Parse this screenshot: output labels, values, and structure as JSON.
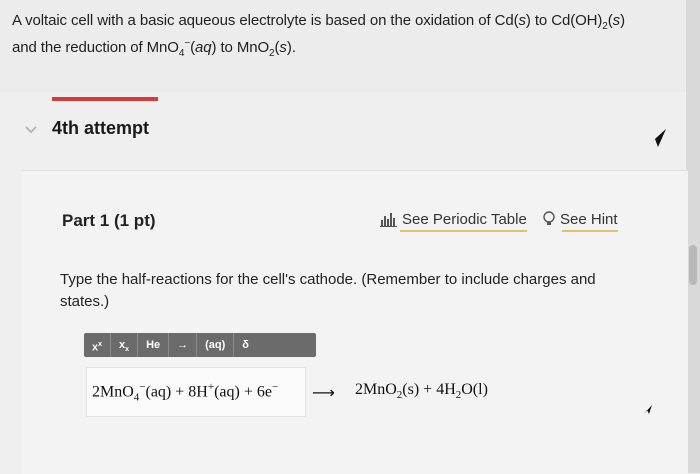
{
  "question": {
    "line1_a": "A voltaic cell with a basic aqueous electrolyte is based on the oxidation of Cd(",
    "line1_s1": "s",
    "line1_b": ") to Cd(OH)",
    "line1_sub2": "2",
    "line1_c": "(",
    "line1_s2": "s",
    "line1_d": ")",
    "line2_a": "and the reduction of MnO",
    "line2_sub4": "4",
    "line2_sup": "−",
    "line2_b": "(",
    "line2_aq": "aq",
    "line2_c": ") to MnO",
    "line2_sub2": "2",
    "line2_d": "(",
    "line2_s": "s",
    "line2_e": ")."
  },
  "attempt": {
    "label": "4th attempt"
  },
  "part": {
    "title": "Part 1  (1 pt)",
    "periodic_table": "See Periodic Table",
    "see_hint": "See Hint",
    "instruction": "Type the half-reactions for the cell's cathode. (Remember to include charges and states.)"
  },
  "toolbar": {
    "superscript": "x",
    "subscript": "x",
    "he": "He",
    "arrow": "→",
    "aq": "(aq)",
    "delta": "δ"
  },
  "equation": {
    "left_coef": "2MnO",
    "left_sub": "4",
    "left_sup": "−",
    "left_state": "(aq) + 8H",
    "left_hsup": "+",
    "left_state2": "(aq) + 6e",
    "left_esup": "−",
    "arrow": "⟶",
    "right_a": "2MnO",
    "right_sub": "2",
    "right_b": "(s) + 4H",
    "right_sub2": "2",
    "right_c": "O(l)"
  },
  "colors": {
    "accent_red": "#d63b3b",
    "link_underline": "#e0c26e",
    "toolbar_bg": "#6b6b6b"
  }
}
